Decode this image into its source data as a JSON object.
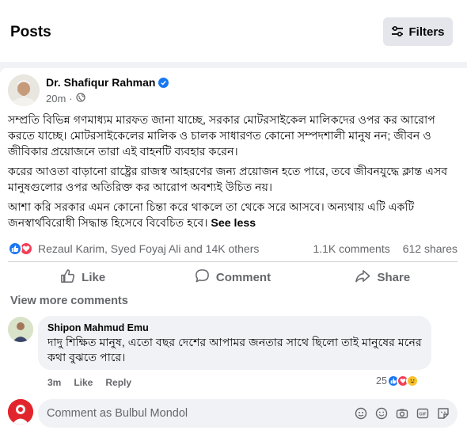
{
  "header": {
    "title": "Posts",
    "filters_label": "Filters"
  },
  "post": {
    "author": "Dr. Shafiqur Rahman",
    "time": "20m",
    "separator": "·",
    "paragraphs": [
      "সম্প্রতি বিভিন্ন গণমাধ্যম মারফত জানা যাচ্ছে, সরকার মোটরসাইকেল মালিকদের ওপর কর আরোপ করতে যাচ্ছে। মোটরসাইকেলের মালিক ও চালক সাধারণত কোনো সম্পদশালী মানুষ নন; জীবন ও জীবিকার প্রয়োজনে তারা এই বাহনটি ব্যবহার করেন।",
      "করের আওতা বাড়ানো রাষ্ট্রের রাজস্ব আহরণের জন্য প্রয়োজন হতে পারে, তবে জীবনযুদ্ধে ক্লান্ত এসব মানুষগুলোর ওপর অতিরিক্ত কর আরোপ অবশ্যই উচিত নয়।",
      "আশা করি সরকার এমন কোনো চিন্তা করে থাকলে তা থেকে সরে আসবে। অন্যথায় এটি একটি জনস্বার্থবিরোধী সিদ্ধান্ত হিসেবে বিবেচিত হবে।"
    ],
    "see_less": "See less",
    "reactions_text": "Rezaul Karim, Syed Foyaj Ali and 14K others",
    "comments_count": "1.1K comments",
    "shares_count": "612 shares",
    "actions": {
      "like": "Like",
      "comment": "Comment",
      "share": "Share"
    }
  },
  "comments": {
    "view_more": "View more comments",
    "items": [
      {
        "author": "Shipon Mahmud Emu",
        "text": "দাদু শিক্ষিত মানুষ, এতো বছর দেশের আপামর জনতার সাথে ছিলো তাই মানুষের মনের কথা বুঝতে পারে।",
        "time": "3m",
        "like": "Like",
        "reply": "Reply",
        "reaction_count": "25"
      }
    ]
  },
  "composer": {
    "placeholder": "Comment as Bulbul Mondol"
  },
  "colors": {
    "accent": "#1877f2",
    "love": "#f33e58",
    "secondary_text": "#65676b",
    "bubble": "#f0f2f5"
  },
  "icons": [
    "filters-icon",
    "verified-badge-icon",
    "globe-icon",
    "like-reaction-icon",
    "love-reaction-icon",
    "thumbs-up-icon",
    "comment-icon",
    "share-icon",
    "haha-reaction-icon",
    "avatar-sticker-icon",
    "emoji-icon",
    "camera-icon",
    "gif-icon",
    "sticker-icon"
  ]
}
